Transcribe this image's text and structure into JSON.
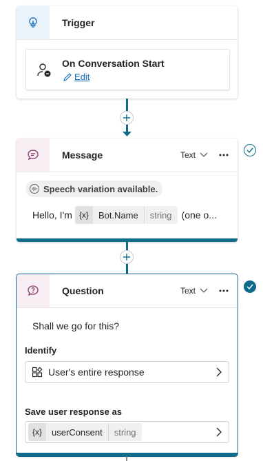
{
  "colors": {
    "accent": "#0e6b8c",
    "link": "#0f6cbd",
    "message_tile": "#f7eef3",
    "trigger_tile": "#eaf3fb"
  },
  "trigger": {
    "title": "Trigger",
    "icon": "trigger-icon",
    "item": {
      "title": "On Conversation Start",
      "edit_label": "Edit",
      "icon": "conversation-user-icon"
    }
  },
  "message": {
    "title": "Message",
    "icon": "message-bubble-icon",
    "type_label": "Text",
    "speech_badge": "Speech variation available.",
    "text_prefix": "Hello, I'm",
    "var_token": "{x}",
    "var_name": "Bot.Name",
    "var_type": "string",
    "text_suffix": "(one o..."
  },
  "question": {
    "title": "Question",
    "icon": "question-bubble-icon",
    "type_label": "Text",
    "prompt": "Shall we go for this?",
    "identify_label": "Identify",
    "identify_value": "User's entire response",
    "save_label": "Save user response as",
    "var_token": "{x}",
    "var_name": "userConsent",
    "var_type": "string"
  }
}
